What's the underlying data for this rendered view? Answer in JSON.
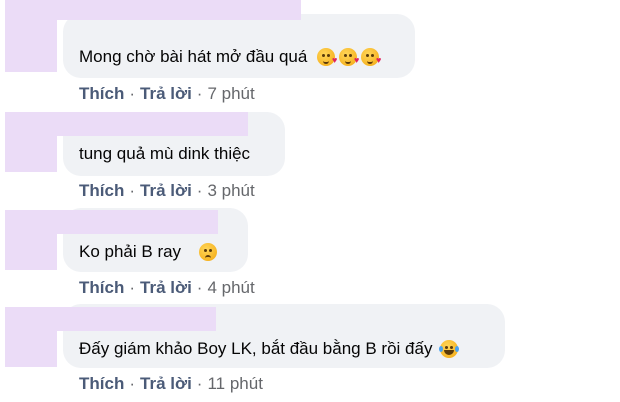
{
  "comments": [
    {
      "text": "Mong chờ bài hát mở đầu quá",
      "emojis": [
        "kissing-heart-emoji",
        "kissing-heart-emoji",
        "kissing-heart-emoji"
      ],
      "like_label": "Thích",
      "reply_label": "Trả lời",
      "time": "7 phút"
    },
    {
      "text": "tung quả mù dink thiệc",
      "emojis": [],
      "like_label": "Thích",
      "reply_label": "Trả lời",
      "time": "3 phút"
    },
    {
      "text": "Ko phải B ray",
      "emojis": [
        "disappointed-emoji"
      ],
      "like_label": "Thích",
      "reply_label": "Trả lời",
      "time": "4 phút"
    },
    {
      "text": "Đấy giám khảo Boy LK, bắt đầu bằng B rồi đấy",
      "emojis": [
        "rolling-laughing-emoji"
      ],
      "like_label": "Thích",
      "reply_label": "Trả lời",
      "time": "11 phút"
    }
  ],
  "colors": {
    "bubble": "#f0f2f5",
    "redaction": "#ebdcf7",
    "action_text": "#4b5b78",
    "time_text": "#65676b"
  }
}
